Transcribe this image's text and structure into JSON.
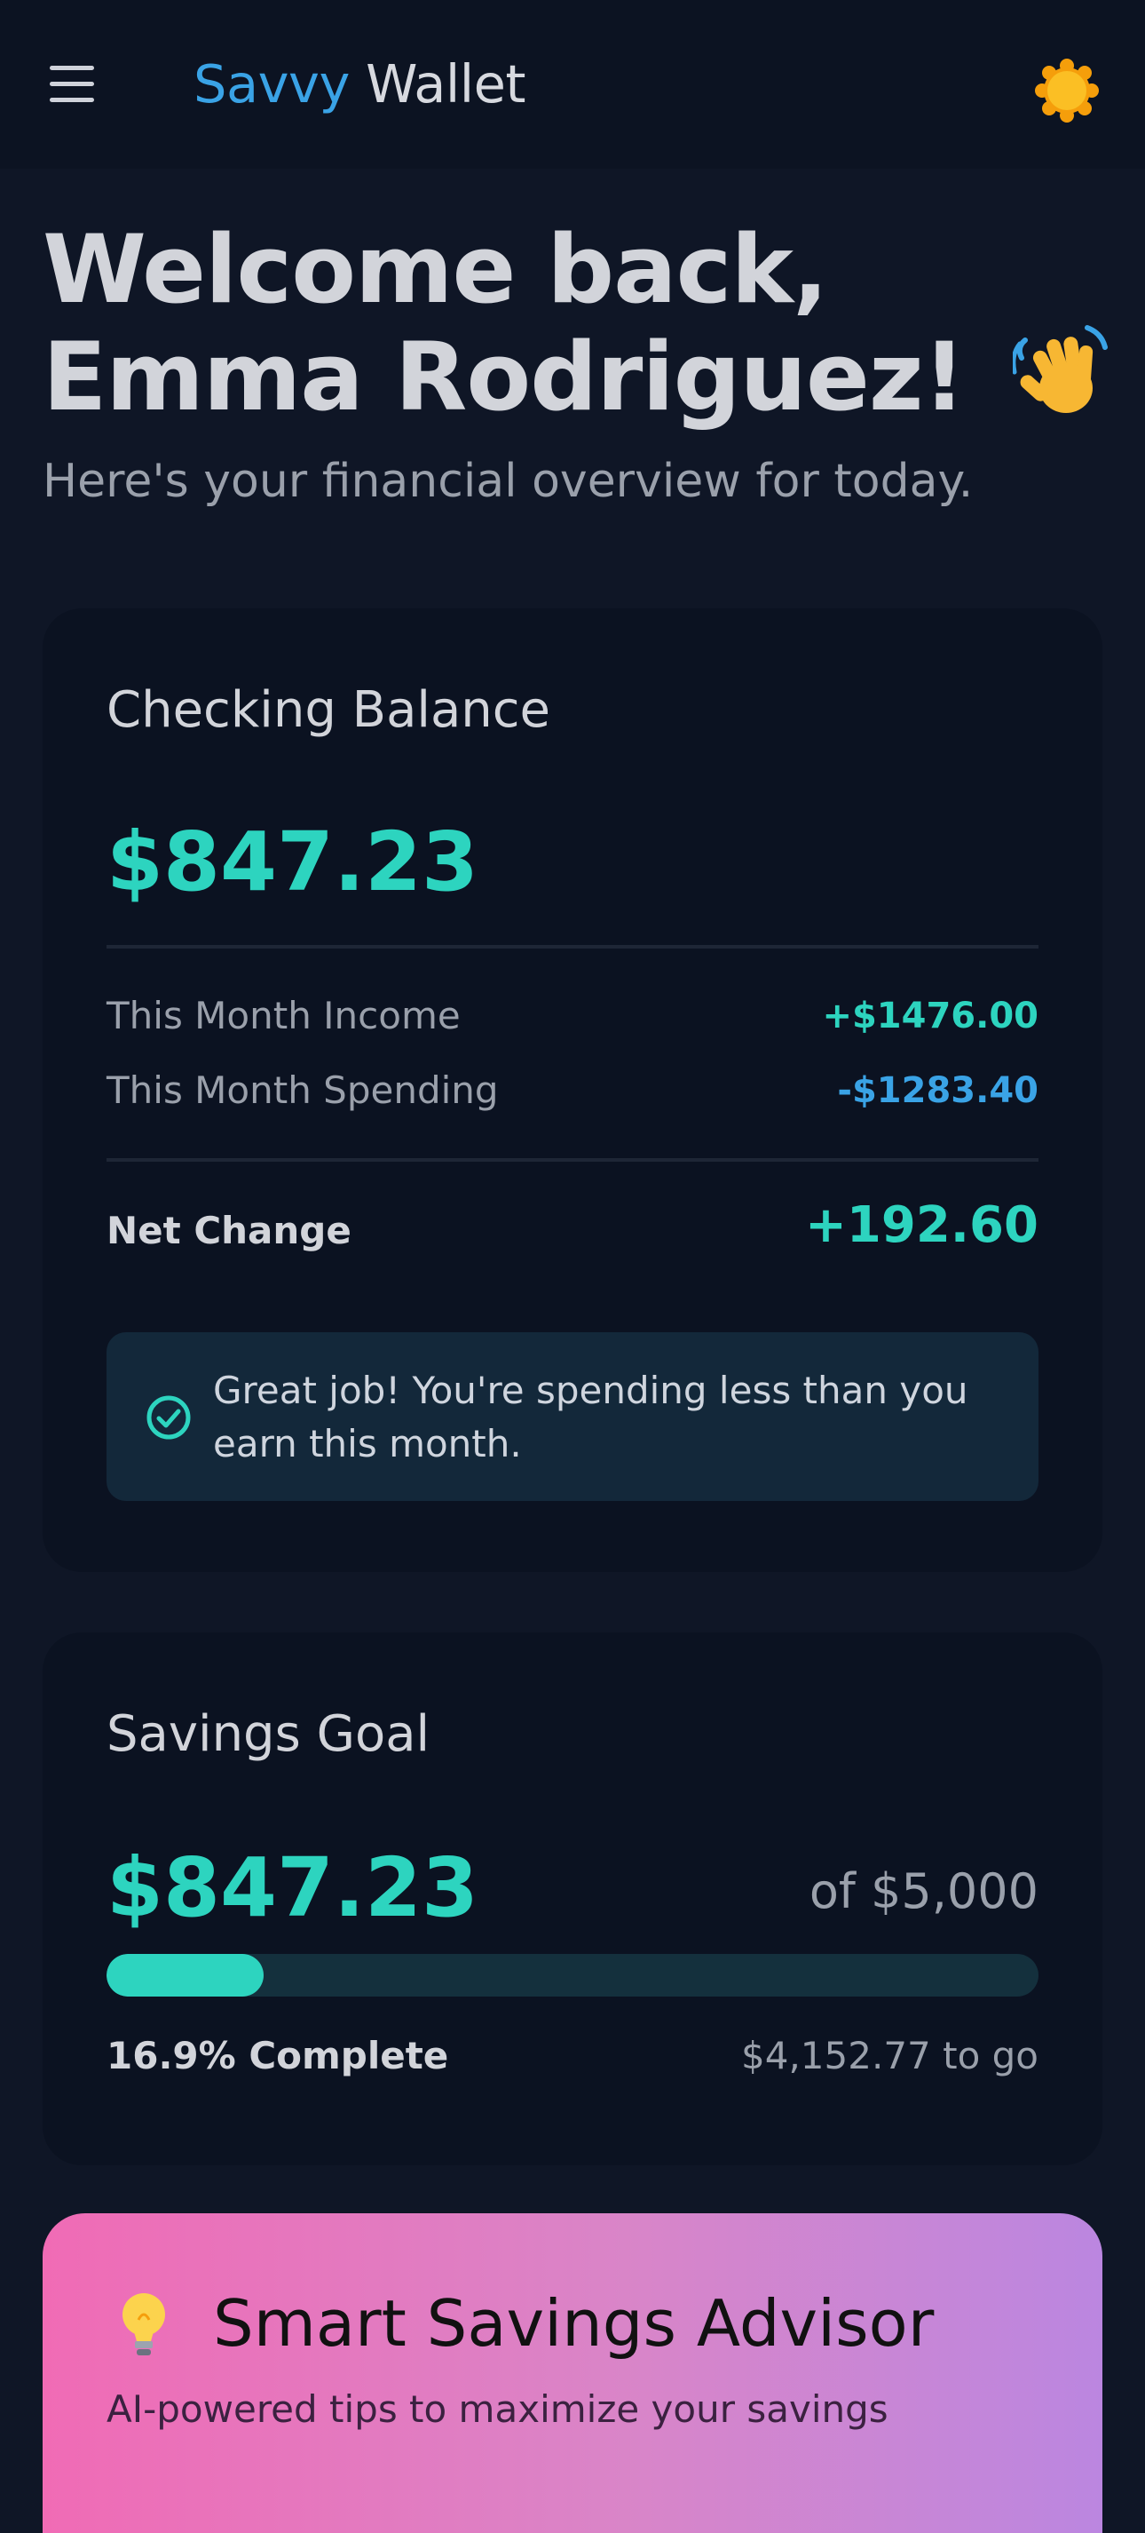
{
  "header": {
    "brand_first": "Savvy",
    "brand_second": "Wallet",
    "menu_icon": "hamburger-menu-icon",
    "theme_icon": "sun-icon"
  },
  "welcome": {
    "title": "Welcome back, Emma Rodriguez!",
    "wave_icon": "waving-hand-icon",
    "subtitle": "Here's your financial overview for today."
  },
  "checking": {
    "title": "Checking Balance",
    "balance": "$847.23",
    "income_label": "This Month Income",
    "income_value": "+$1476.00",
    "spending_label": "This Month Spending",
    "spending_value": "-$1283.40",
    "net_label": "Net Change",
    "net_value": "+192.60",
    "notice_icon": "check-circle-icon",
    "notice_text": "Great job! You're spending less than you earn this month."
  },
  "savings": {
    "title": "Savings Goal",
    "amount": "$847.23",
    "goal_text": "of $5,000",
    "progress_percent": 16.9,
    "complete_text": "16.9% Complete",
    "remaining_text": "$4,152.77 to go"
  },
  "advisor": {
    "icon": "lightbulb-icon",
    "title": "Smart Savings Advisor",
    "subtitle": "AI-powered tips to maximize your savings"
  },
  "colors": {
    "background": "#0f1626",
    "accent_teal": "#2dd4bf",
    "accent_blue": "#3aa3e6",
    "card": "#0b1221"
  }
}
